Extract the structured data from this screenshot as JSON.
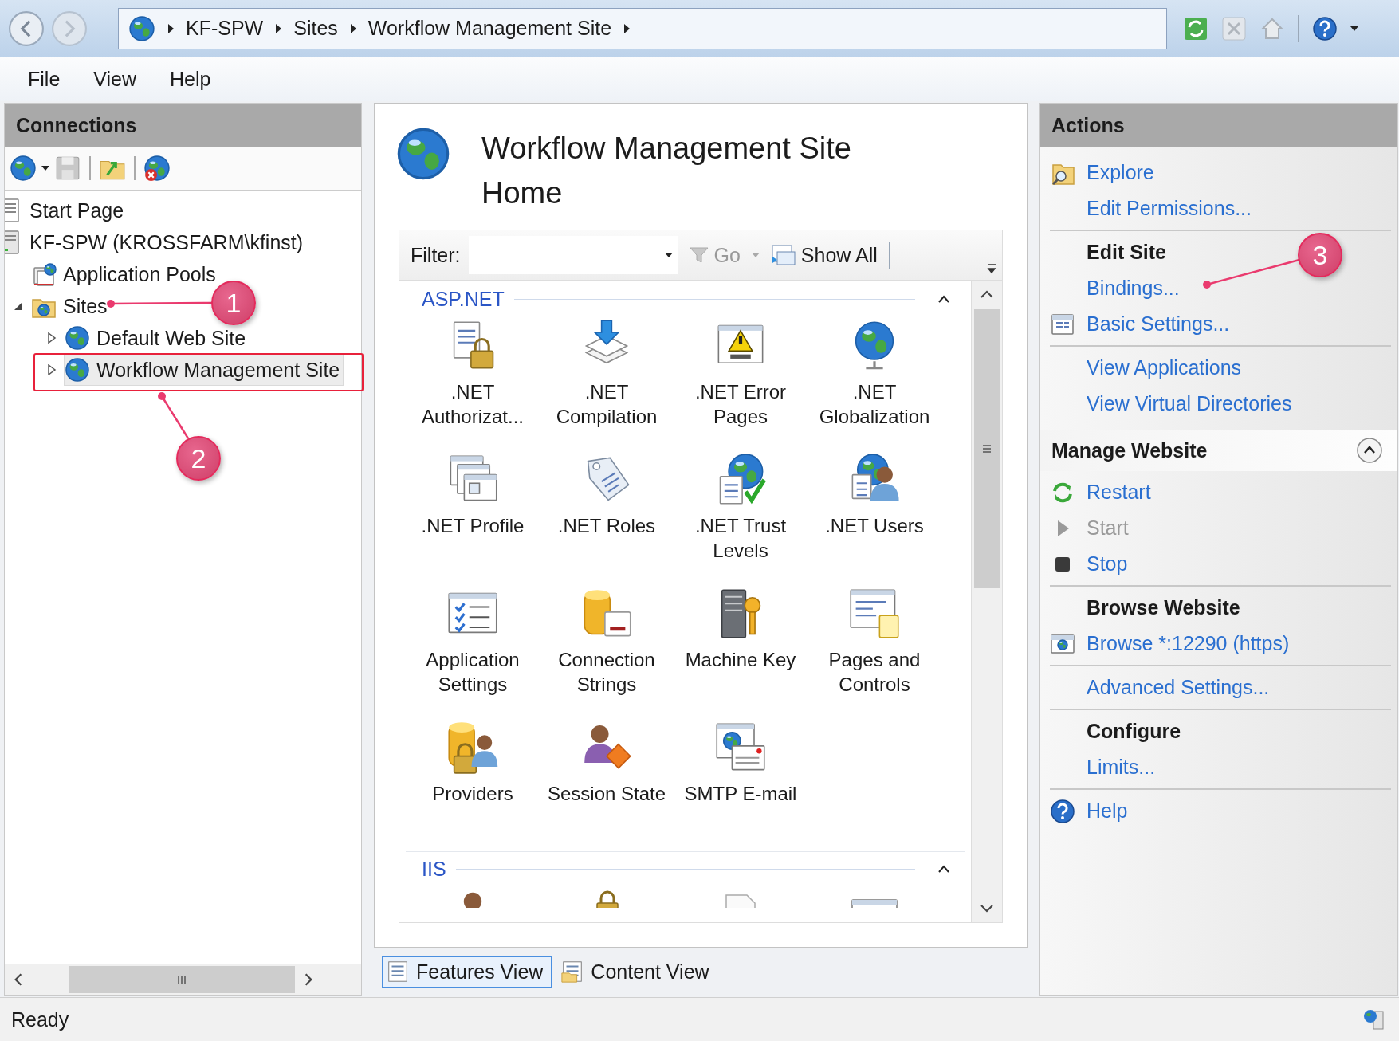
{
  "address_bar": {
    "breadcrumbs": [
      "KF-SPW",
      "Sites",
      "Workflow Management Site"
    ]
  },
  "menu": [
    "File",
    "View",
    "Help"
  ],
  "connections": {
    "title": "Connections",
    "tree": [
      {
        "label": "Start Page",
        "kind": "start",
        "selected": false
      },
      {
        "label": "KF-SPW (KROSSFARM\\kfinst)",
        "kind": "server",
        "selected": false,
        "children": [
          {
            "label": "Application Pools",
            "kind": "pools",
            "selected": false
          },
          {
            "label": "Sites",
            "kind": "sites",
            "selected": false,
            "expanded": true,
            "children": [
              {
                "label": "Default Web Site",
                "kind": "site",
                "selected": false,
                "expanded": false
              },
              {
                "label": "Workflow Management Site",
                "kind": "site",
                "selected": true,
                "expanded": false
              }
            ]
          }
        ]
      }
    ]
  },
  "home": {
    "title": "Workflow Management Site Home",
    "filter": {
      "label": "Filter:",
      "go": "Go",
      "show_all": "Show All"
    },
    "groups": [
      {
        "title": "ASP.NET",
        "expanded": true,
        "features": [
          {
            "label": ".NET Authorizat...",
            "kind": "auth"
          },
          {
            "label": ".NET Compilation",
            "kind": "compile"
          },
          {
            "label": ".NET Error Pages",
            "kind": "error"
          },
          {
            "label": ".NET Globalization",
            "kind": "glob"
          },
          {
            "label": ".NET Profile",
            "kind": "profile"
          },
          {
            "label": ".NET Roles",
            "kind": "roles"
          },
          {
            "label": ".NET Trust Levels",
            "kind": "trust"
          },
          {
            "label": ".NET Users",
            "kind": "users"
          },
          {
            "label": "Application Settings",
            "kind": "appset"
          },
          {
            "label": "Connection Strings",
            "kind": "connstr"
          },
          {
            "label": "Machine Key",
            "kind": "machinekey"
          },
          {
            "label": "Pages and Controls",
            "kind": "pages"
          },
          {
            "label": "Providers",
            "kind": "providers"
          },
          {
            "label": "Session State",
            "kind": "session"
          },
          {
            "label": "SMTP E-mail",
            "kind": "smtp"
          }
        ]
      },
      {
        "title": "IIS",
        "expanded": true,
        "features": [
          {
            "kind": "user"
          },
          {
            "kind": "lock"
          },
          {
            "kind": "doc"
          },
          {
            "kind": "window"
          }
        ]
      }
    ]
  },
  "view_tabs": [
    {
      "label": "Features View",
      "selected": true
    },
    {
      "label": "Content View",
      "selected": false
    }
  ],
  "actions": {
    "title": "Actions",
    "blocks": [
      {
        "kind": "links",
        "items": [
          {
            "label": "Explore",
            "kind": "explore",
            "disabled": false
          },
          {
            "label": "Edit Permissions...",
            "disabled": false
          }
        ]
      },
      {
        "kind": "links",
        "heading": "Edit Site",
        "items": [
          {
            "label": "Bindings...",
            "disabled": false
          },
          {
            "label": "Basic Settings...",
            "kind": "form",
            "disabled": false
          }
        ]
      },
      {
        "kind": "links",
        "items": [
          {
            "label": "View Applications",
            "disabled": false
          },
          {
            "label": "View Virtual Directories",
            "disabled": false
          }
        ]
      },
      {
        "kind": "group",
        "title": "Manage Website",
        "expanded": true
      },
      {
        "kind": "links",
        "items": [
          {
            "label": "Restart",
            "kind": "restart",
            "disabled": false
          },
          {
            "label": "Start",
            "kind": "play",
            "disabled": true
          },
          {
            "label": "Stop",
            "kind": "stop",
            "disabled": false
          }
        ]
      },
      {
        "kind": "links",
        "heading": "Browse Website",
        "items": [
          {
            "label": "Browse *:12290 (https)",
            "kind": "browse",
            "disabled": false
          }
        ]
      },
      {
        "kind": "links",
        "items": [
          {
            "label": "Advanced Settings...",
            "disabled": false
          }
        ]
      },
      {
        "kind": "links",
        "heading": "Configure",
        "items": [
          {
            "label": "Limits...",
            "disabled": false
          }
        ]
      },
      {
        "kind": "links",
        "items": [
          {
            "label": "Help",
            "kind": "help",
            "disabled": false
          }
        ]
      }
    ]
  },
  "status_bar": {
    "text": "Ready"
  },
  "annotations": [
    {
      "label": "1"
    },
    {
      "label": "2"
    },
    {
      "label": "3"
    }
  ]
}
